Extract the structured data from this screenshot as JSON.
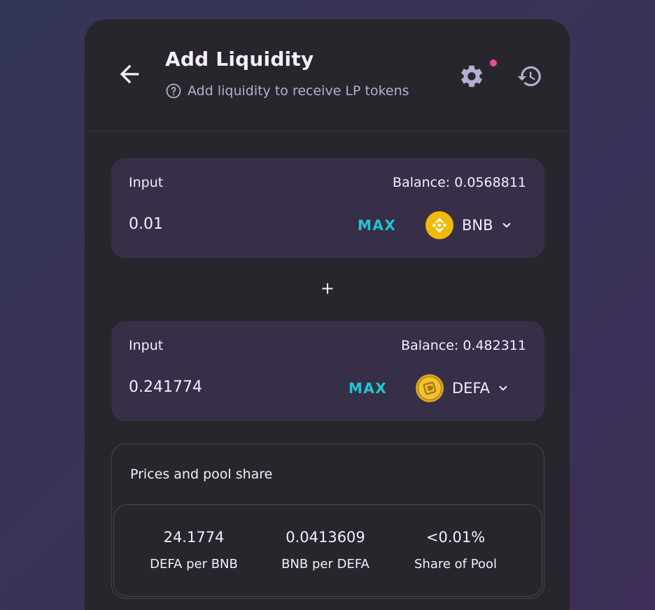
{
  "header": {
    "title": "Add Liquidity",
    "subtitle": "Add liquidity to receive LP tokens"
  },
  "inputs": [
    {
      "label": "Input",
      "balance": "Balance: 0.0568811",
      "amount": "0.01",
      "max_label": "MAX",
      "token": "BNB"
    },
    {
      "label": "Input",
      "balance": "Balance: 0.482311",
      "amount": "0.241774",
      "max_label": "MAX",
      "token": "DEFA"
    }
  ],
  "separator": "+",
  "pool": {
    "title": "Prices and pool share",
    "stats": [
      {
        "value": "24.1774",
        "label": "DEFA per BNB"
      },
      {
        "value": "0.0413609",
        "label": "BNB per DEFA"
      },
      {
        "value": "<0.01%",
        "label": "Share of Pool"
      }
    ]
  },
  "colors": {
    "accent": "#1fc7d4",
    "notification": "#ed4b9e",
    "panel": "#372f47",
    "card": "#27262c",
    "token_gold": "#f0b90b"
  },
  "icons": [
    "back-arrow-icon",
    "help-circle-icon",
    "settings-gear-icon",
    "history-icon",
    "bnb-token-icon",
    "defa-token-icon",
    "chevron-down-icon"
  ]
}
